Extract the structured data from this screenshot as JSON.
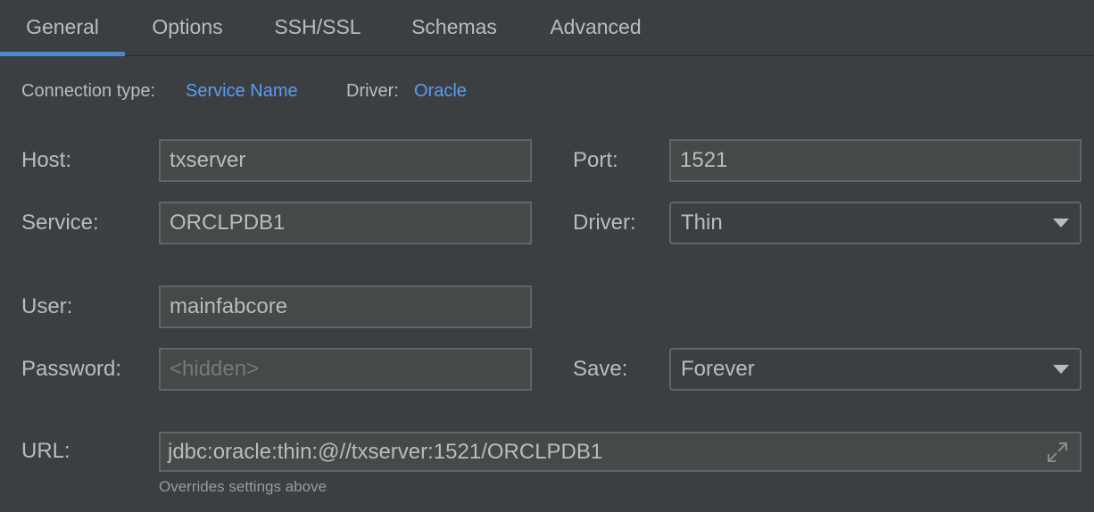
{
  "tabs": [
    {
      "label": "General",
      "selected": true
    },
    {
      "label": "Options",
      "selected": false
    },
    {
      "label": "SSH/SSL",
      "selected": false
    },
    {
      "label": "Schemas",
      "selected": false
    },
    {
      "label": "Advanced",
      "selected": false
    }
  ],
  "connection": {
    "type_label": "Connection type:",
    "type_value": "Service Name",
    "driver_label": "Driver:",
    "driver_value": "Oracle"
  },
  "form": {
    "host": {
      "label": "Host:",
      "value": "txserver"
    },
    "port": {
      "label": "Port:",
      "value": "1521"
    },
    "service": {
      "label": "Service:",
      "value": "ORCLPDB1"
    },
    "driver": {
      "label": "Driver:",
      "value": "Thin"
    },
    "user": {
      "label": "User:",
      "value": "mainfabcore"
    },
    "password": {
      "label": "Password:",
      "placeholder": "<hidden>"
    },
    "save": {
      "label": "Save:",
      "value": "Forever"
    },
    "url": {
      "label": "URL:",
      "value": "jdbc:oracle:thin:@//txserver:1521/ORCLPDB1",
      "hint": "Overrides settings above"
    }
  },
  "colors": {
    "background": "#3c3f41",
    "accent": "#4a88c7",
    "link": "#589df6"
  }
}
